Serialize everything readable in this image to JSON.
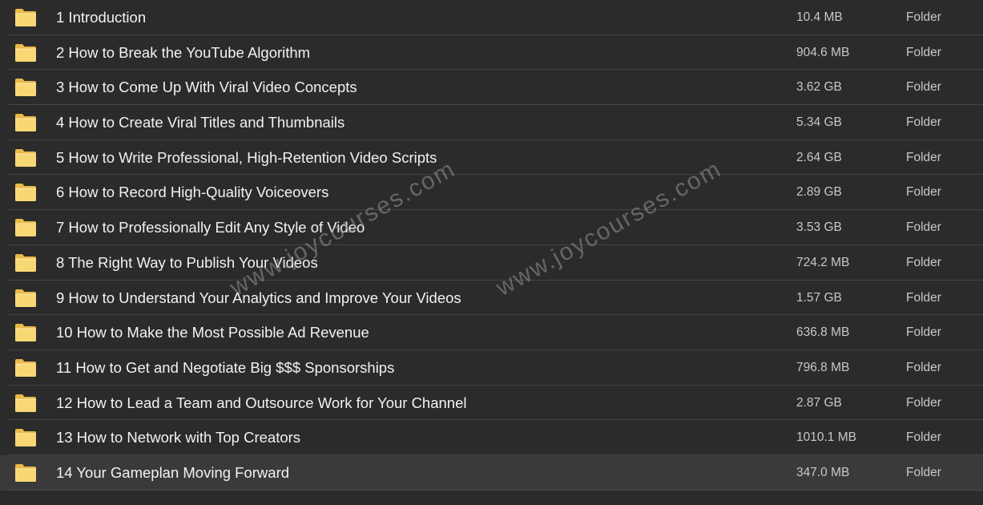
{
  "colors": {
    "background": "#2b2b2b",
    "row_divider": "#444444",
    "selected_row": "#3a3a3a",
    "folder_fill": "#f8d775",
    "folder_tab": "#e9b949"
  },
  "icons": {
    "folder": "folder-icon"
  },
  "files": [
    {
      "name": "1 Introduction",
      "size": "10.4 MB",
      "kind": "Folder"
    },
    {
      "name": "2 How to Break the YouTube Algorithm",
      "size": "904.6 MB",
      "kind": "Folder"
    },
    {
      "name": "3 How to Come Up With Viral Video Concepts",
      "size": "3.62 GB",
      "kind": "Folder"
    },
    {
      "name": "4 How to Create Viral Titles and Thumbnails",
      "size": "5.34 GB",
      "kind": "Folder"
    },
    {
      "name": "5 How to Write Professional, High-Retention Video Scripts",
      "size": "2.64 GB",
      "kind": "Folder"
    },
    {
      "name": "6 How to Record High-Quality Voiceovers",
      "size": "2.89 GB",
      "kind": "Folder"
    },
    {
      "name": "7 How to Professionally Edit Any Style of Video",
      "size": "3.53 GB",
      "kind": "Folder"
    },
    {
      "name": "8 The Right Way to Publish Your Videos",
      "size": "724.2 MB",
      "kind": "Folder"
    },
    {
      "name": "9 How to Understand Your Analytics and Improve Your Videos",
      "size": "1.57 GB",
      "kind": "Folder"
    },
    {
      "name": "10 How to Make the Most Possible Ad Revenue",
      "size": "636.8 MB",
      "kind": "Folder"
    },
    {
      "name": "11 How to Get and Negotiate Big $$$ Sponsorships",
      "size": "796.8 MB",
      "kind": "Folder"
    },
    {
      "name": "12 How to Lead a Team and Outsource Work for Your Channel",
      "size": "2.87 GB",
      "kind": "Folder"
    },
    {
      "name": "13 How to Network with Top Creators",
      "size": "1010.1 MB",
      "kind": "Folder"
    },
    {
      "name": "14 Your Gameplan Moving Forward",
      "size": "347.0 MB",
      "kind": "Folder",
      "selected": true
    }
  ],
  "watermarks": [
    {
      "text": "www.joycourses.com"
    },
    {
      "text": "www.joycourses.com"
    }
  ]
}
